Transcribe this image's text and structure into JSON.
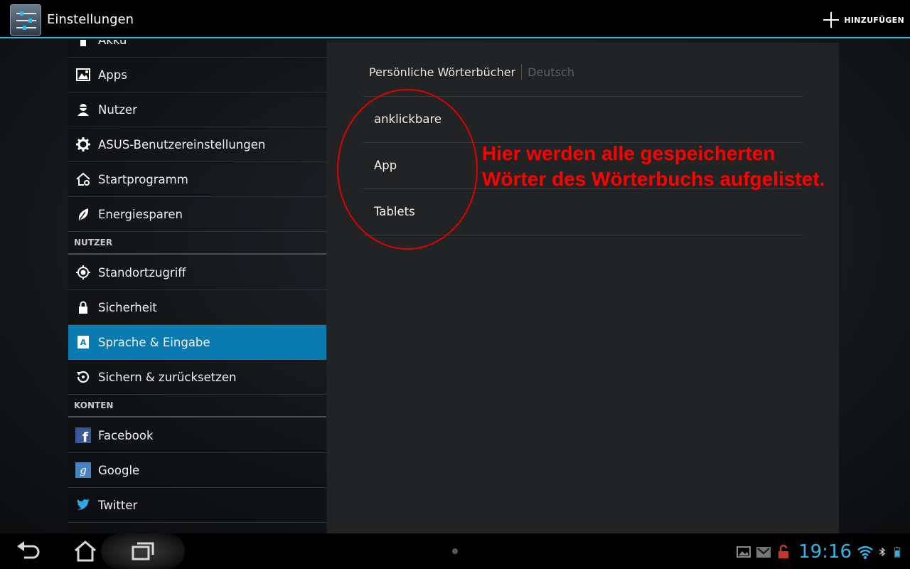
{
  "header": {
    "app_title": "Einstellungen",
    "add_label": "HINZUFÜGEN"
  },
  "sidebar": {
    "items": [
      {
        "label": "Akku",
        "icon": "battery-icon"
      },
      {
        "label": "Apps",
        "icon": "apps-icon"
      },
      {
        "label": "Nutzer",
        "icon": "user-icon"
      },
      {
        "label": "ASUS-Benutzereinstellungen",
        "icon": "gear-icon"
      },
      {
        "label": "Startprogramm",
        "icon": "home-gear-icon"
      },
      {
        "label": "Energiesparen",
        "icon": "leaf-icon"
      },
      {
        "section": "NUTZER"
      },
      {
        "label": "Standortzugriff",
        "icon": "location-icon"
      },
      {
        "label": "Sicherheit",
        "icon": "lock-icon"
      },
      {
        "label": "Sprache & Eingabe",
        "icon": "language-icon",
        "selected": true
      },
      {
        "label": "Sichern & zurücksetzen",
        "icon": "backup-icon"
      },
      {
        "section": "KONTEN"
      },
      {
        "label": "Facebook",
        "icon": "facebook-icon"
      },
      {
        "label": "Google",
        "icon": "google-icon"
      },
      {
        "label": "Twitter",
        "icon": "twitter-icon"
      }
    ]
  },
  "panel": {
    "breadcrumb_main": "Persönliche Wörterbücher",
    "breadcrumb_sub": "Deutsch",
    "words": [
      "anklickbare",
      "App",
      "Tablets"
    ]
  },
  "annotation": {
    "line1": "Hier werden alle gespeicherten",
    "line2": "Wörter des Wörterbuchs aufgelistet."
  },
  "statusbar": {
    "time": "19:16"
  },
  "colors": {
    "accent": "#33b5e5",
    "selected_row": "#0a7bb0",
    "annotation": "#ff0000"
  }
}
